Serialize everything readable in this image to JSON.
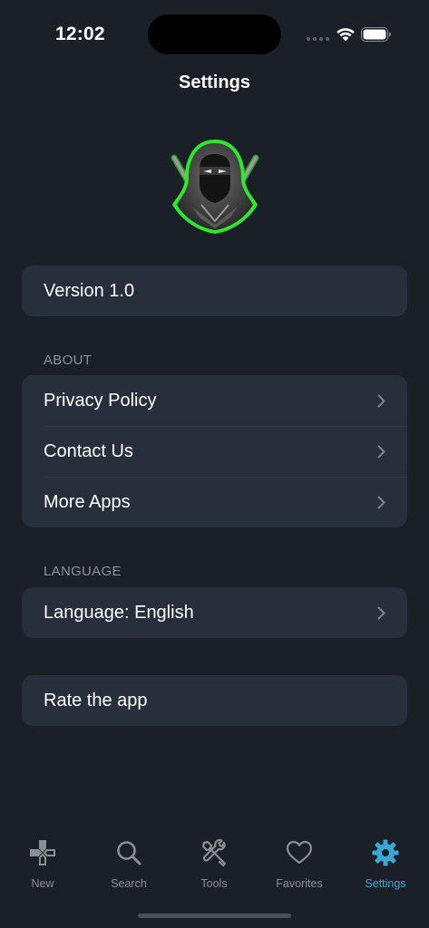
{
  "status_bar": {
    "time": "12:02"
  },
  "header": {
    "title": "Settings"
  },
  "version_card": {
    "label": "Version 1.0"
  },
  "about": {
    "header": "ABOUT",
    "items": [
      {
        "label": "Privacy Policy"
      },
      {
        "label": "Contact Us"
      },
      {
        "label": "More Apps"
      }
    ]
  },
  "language": {
    "header": "LANGUAGE",
    "item_label": "Language: English"
  },
  "rate": {
    "label": "Rate the app"
  },
  "tabbar": {
    "tabs": [
      {
        "label": "New",
        "icon": "gamepad-icon"
      },
      {
        "label": "Search",
        "icon": "search-icon"
      },
      {
        "label": "Tools",
        "icon": "tools-icon"
      },
      {
        "label": "Favorites",
        "icon": "heart-icon"
      },
      {
        "label": "Settings",
        "icon": "gear-icon"
      }
    ],
    "active_tab": "Settings"
  },
  "colors": {
    "background": "#1b2028",
    "card": "#262f3b",
    "accent": "#3ba7d6",
    "logo_glow": "#2ee82e"
  }
}
